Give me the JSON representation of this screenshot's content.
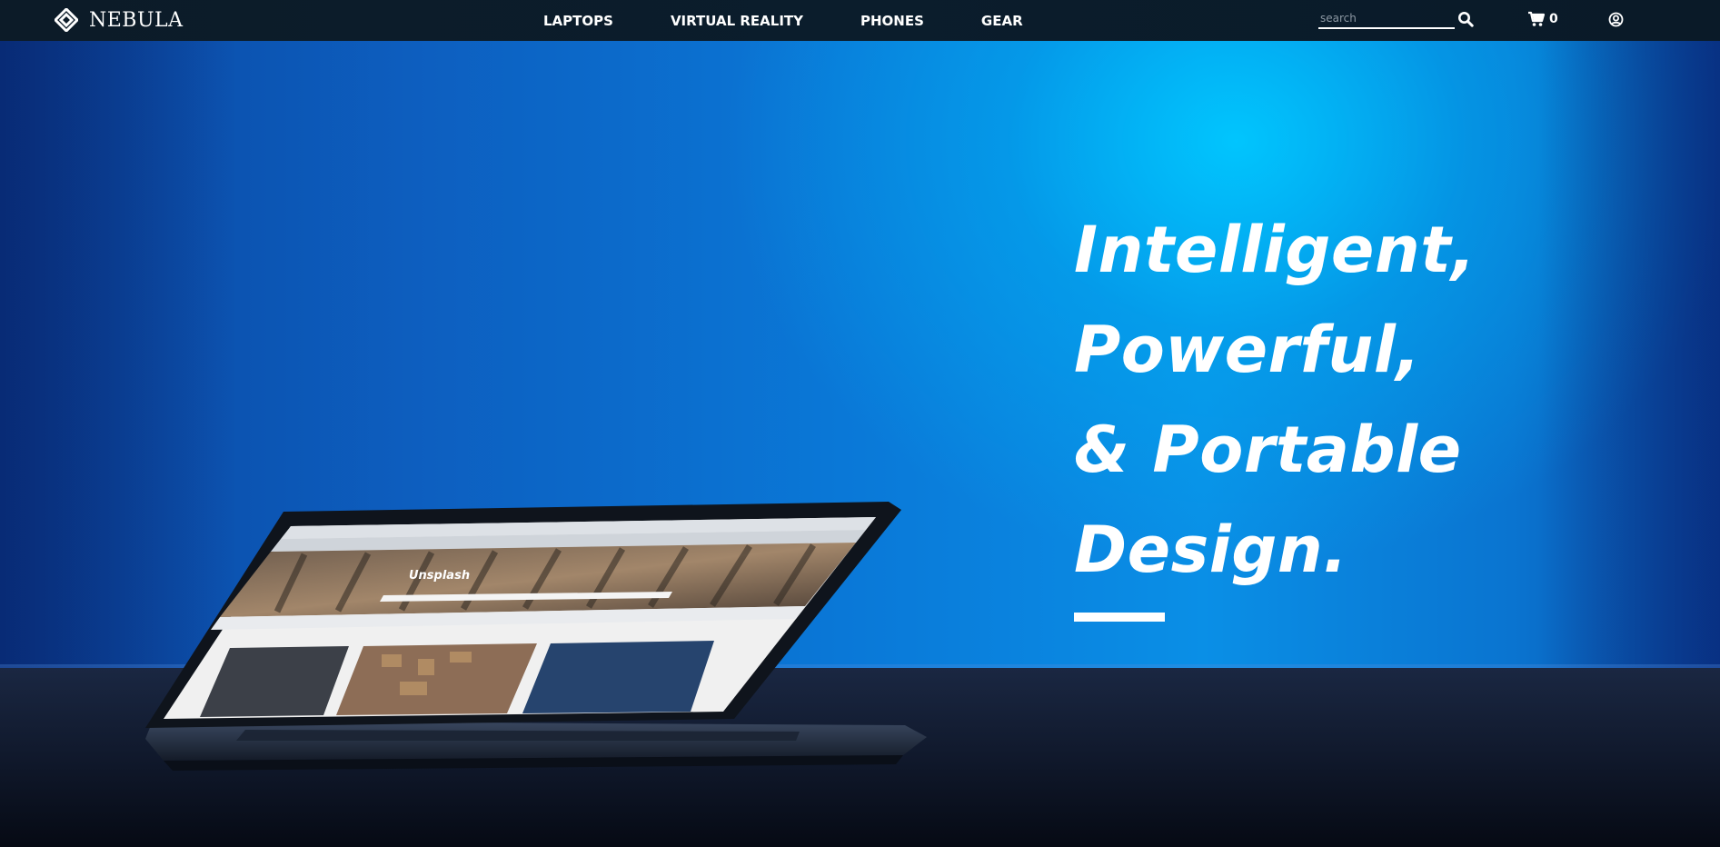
{
  "brand": {
    "name": "NEBULA",
    "logo_icon": "diamond-logo-icon"
  },
  "nav": {
    "links": [
      {
        "label": "LAPTOPS"
      },
      {
        "label": "VIRTUAL REALITY"
      },
      {
        "label": "PHONES"
      },
      {
        "label": "GEAR"
      }
    ]
  },
  "search": {
    "placeholder": "search",
    "value": "",
    "icon": "search-icon"
  },
  "cart": {
    "icon": "shopping-cart-icon",
    "count": "0"
  },
  "account": {
    "icon": "user-circle-icon"
  },
  "hero": {
    "lines": [
      "Intelligent,",
      "Powerful,",
      "& Portable",
      "Design."
    ],
    "screen_title": "Unsplash"
  },
  "colors": {
    "navbar": "#0b1d2c",
    "hero_blue": "#0a8fe6",
    "glow": "#00c8ff",
    "text": "#ffffff"
  }
}
